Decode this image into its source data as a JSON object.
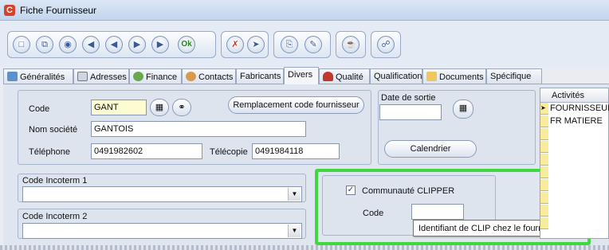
{
  "window": {
    "title": "Fiche Fournisseur"
  },
  "toolbar": {
    "groups": [
      {
        "buttons": [
          "new-doc-icon",
          "duplicate-icon",
          "binoculars-icon",
          "first-record-icon",
          "previous-record-icon",
          "next-record-icon",
          "last-record-icon",
          "ok-button"
        ]
      },
      {
        "buttons": [
          "delete-icon",
          "exit-icon"
        ]
      },
      {
        "buttons": [
          "print-icon",
          "preview-icon"
        ]
      },
      {
        "buttons": [
          "basket-icon"
        ]
      },
      {
        "buttons": [
          "attach-icon"
        ]
      }
    ],
    "ok_label": "Ok"
  },
  "tabs": [
    {
      "label": "Généralités",
      "icon": "generalites-icon"
    },
    {
      "label": "Adresses",
      "icon": "adresses-icon"
    },
    {
      "label": "Finance",
      "icon": "finance-icon"
    },
    {
      "label": "Contacts",
      "icon": "contacts-icon"
    },
    {
      "label": "Fabricants"
    },
    {
      "label": "Divers",
      "active": true
    },
    {
      "label": "Qualité",
      "icon": "qualite-icon"
    },
    {
      "label": "Qualification"
    },
    {
      "label": "Documents",
      "icon": "documents-icon"
    },
    {
      "label": "Spécifique"
    }
  ],
  "form": {
    "code_label": "Code",
    "code_value": "GANT",
    "replace_code_button": "Remplacement code fournisseur",
    "nom_label": "Nom société",
    "nom_value": "GANTOIS",
    "tel_label": "Téléphone",
    "tel_value": "0491982602",
    "fax_label": "Télécopie",
    "fax_value": "0491984118",
    "date_sortie_label": "Date de sortie",
    "date_sortie_value": "",
    "calendrier_button": "Calendrier",
    "incoterm1_label": "Code Incoterm 1",
    "incoterm1_value": "",
    "incoterm2_label": "Code Incoterm 2",
    "incoterm2_value": ""
  },
  "clipper": {
    "checkbox_label": "Communauté CLIPPER",
    "checked": true,
    "code_label": "Code",
    "code_value": "",
    "tooltip": "Identifiant de CLIP chez le fournisseur"
  },
  "grid": {
    "header": "Activités",
    "rows": [
      "FOURNISSEUR",
      "FR MATIERE",
      "",
      "",
      "",
      "",
      "",
      "",
      "",
      ""
    ]
  },
  "colors": {
    "highlight": "#3fd83f",
    "title_icon": "#d8402c"
  }
}
